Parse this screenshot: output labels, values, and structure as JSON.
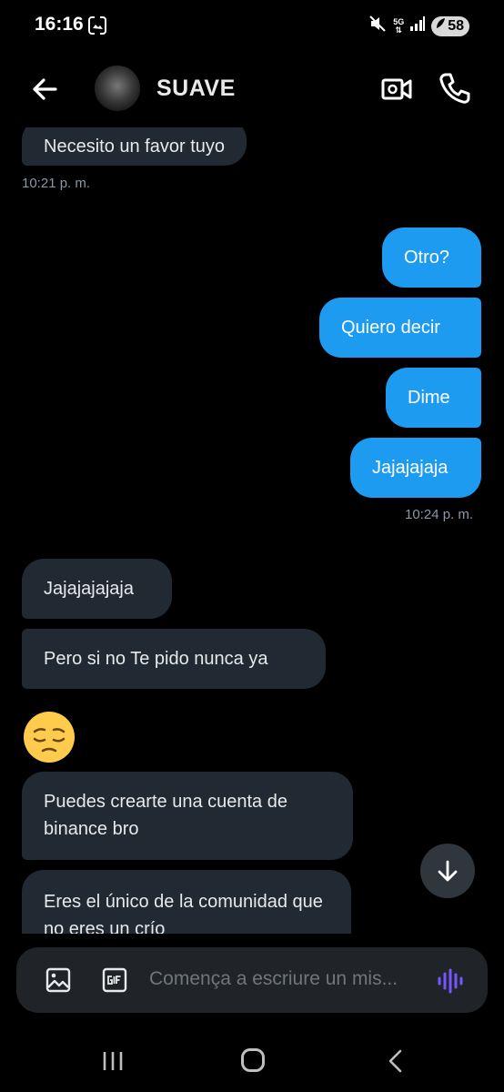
{
  "status_bar": {
    "time": "16:16",
    "network": "5G",
    "battery": "58"
  },
  "header": {
    "contact_name": "SUAVE"
  },
  "messages": [
    {
      "from": "them",
      "text": "Necesito un favor tuyo"
    },
    {
      "from": "me",
      "text": "Otro?"
    },
    {
      "from": "me",
      "text": "Quiero decir"
    },
    {
      "from": "me",
      "text": "Dime"
    },
    {
      "from": "me",
      "text": "Jajajajaja"
    },
    {
      "from": "them",
      "text": "Jajajajajaja"
    },
    {
      "from": "them",
      "text": "Pero si no Te pido nunca ya"
    },
    {
      "from": "them",
      "text": "Puedes crearte una cuenta de binance bro"
    },
    {
      "from": "them",
      "text": "Eres el único de la comunidad que no eres un crío"
    }
  ],
  "timestamps": {
    "first": "10:21 p. m.",
    "second": "10:24 p. m."
  },
  "emoji": {
    "icon": "pensive-face",
    "colors": {
      "face": "#ffcb4c",
      "feature": "#65471b"
    }
  },
  "composer": {
    "placeholder": "Comença a escriure un mis..."
  },
  "colors": {
    "accent": "#1d9bf0",
    "incoming_bubble": "#212a32",
    "voice_icon": "#7856ff"
  }
}
